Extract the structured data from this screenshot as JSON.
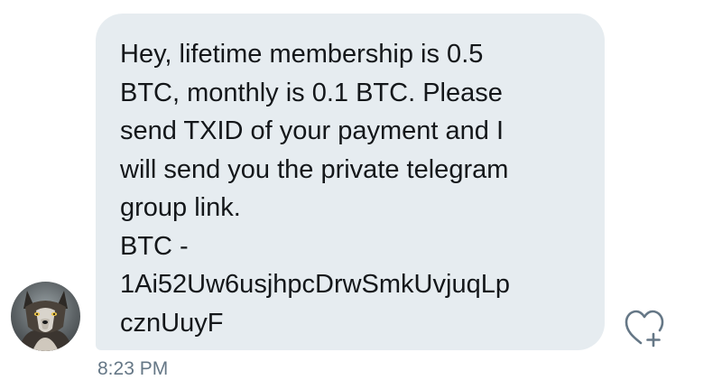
{
  "message": {
    "lines": [
      "Hey, lifetime membership is 0.5",
      "BTC, monthly is 0.1 BTC. Please",
      "send TXID of your payment and I",
      "will send you the private telegram",
      "group link.",
      "BTC -",
      "1Ai52Uw6usjhpcDrwSmkUvjuqLp",
      "cznUuyF"
    ],
    "timestamp": "8:23 PM"
  },
  "sender": {
    "avatar_icon": "wolf-avatar"
  },
  "actions": {
    "like_icon": "heart-plus-icon"
  },
  "colors": {
    "bubble_bg": "#e6ecf0",
    "text": "#14171a",
    "timestamp": "#657786",
    "icon": "#657786"
  }
}
